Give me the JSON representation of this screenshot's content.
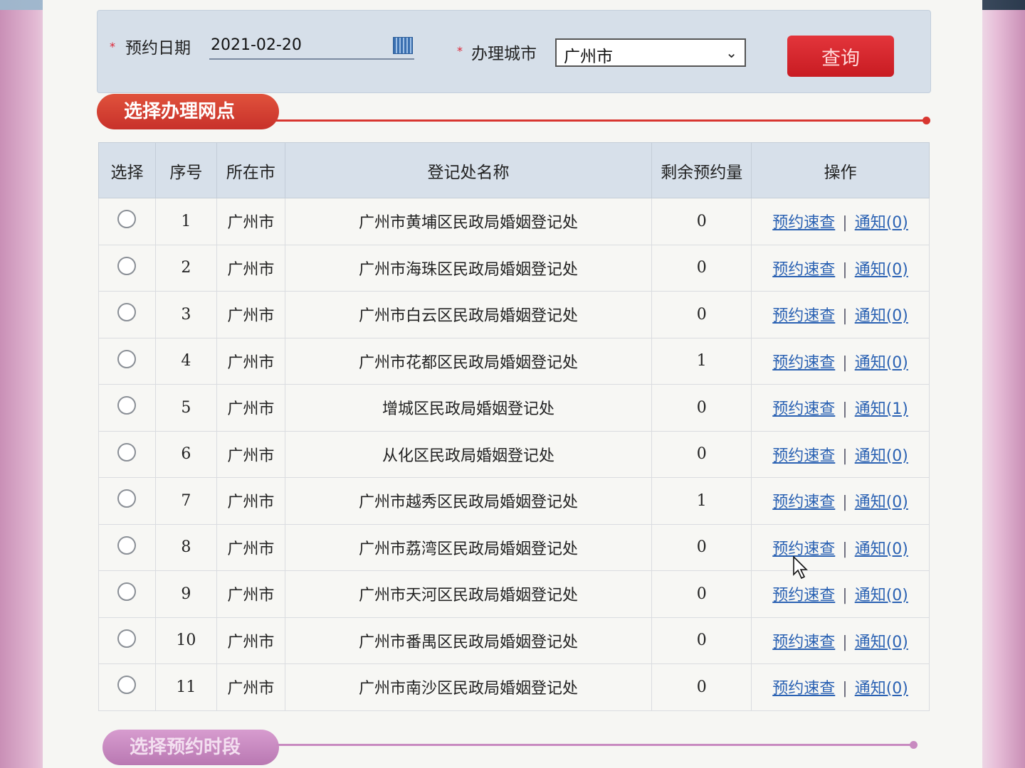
{
  "form": {
    "date_label": "预约日期",
    "date_value": "2021-02-20",
    "city_label": "办理城市",
    "city_value": "广州市",
    "query_button": "查询",
    "required_mark": "*"
  },
  "sections": {
    "select_office": "选择办理网点",
    "select_time": "选择预约时段"
  },
  "table": {
    "headers": [
      "选择",
      "序号",
      "所在市",
      "登记处名称",
      "剩余预约量",
      "操作"
    ],
    "quick_query_label": "预约速查",
    "separator": "|",
    "rows": [
      {
        "seq": "1",
        "city": "广州市",
        "name": "广州市黄埔区民政局婚姻登记处",
        "remaining": "0",
        "notice": "通知(0)"
      },
      {
        "seq": "2",
        "city": "广州市",
        "name": "广州市海珠区民政局婚姻登记处",
        "remaining": "0",
        "notice": "通知(0)"
      },
      {
        "seq": "3",
        "city": "广州市",
        "name": "广州市白云区民政局婚姻登记处",
        "remaining": "0",
        "notice": "通知(0)"
      },
      {
        "seq": "4",
        "city": "广州市",
        "name": "广州市花都区民政局婚姻登记处",
        "remaining": "1",
        "notice": "通知(0)"
      },
      {
        "seq": "5",
        "city": "广州市",
        "name": "增城区民政局婚姻登记处",
        "remaining": "0",
        "notice": "通知(1)"
      },
      {
        "seq": "6",
        "city": "广州市",
        "name": "从化区民政局婚姻登记处",
        "remaining": "0",
        "notice": "通知(0)"
      },
      {
        "seq": "7",
        "city": "广州市",
        "name": "广州市越秀区民政局婚姻登记处",
        "remaining": "1",
        "notice": "通知(0)"
      },
      {
        "seq": "8",
        "city": "广州市",
        "name": "广州市荔湾区民政局婚姻登记处",
        "remaining": "0",
        "notice": "通知(0)"
      },
      {
        "seq": "9",
        "city": "广州市",
        "name": "广州市天河区民政局婚姻登记处",
        "remaining": "0",
        "notice": "通知(0)"
      },
      {
        "seq": "10",
        "city": "广州市",
        "name": "广州市番禺区民政局婚姻登记处",
        "remaining": "0",
        "notice": "通知(0)"
      },
      {
        "seq": "11",
        "city": "广州市",
        "name": "广州市南沙区民政局婚姻登记处",
        "remaining": "0",
        "notice": "通知(0)"
      }
    ]
  },
  "colors": {
    "accent_red": "#d8362f",
    "link_blue": "#2b62b3",
    "section2_pink": "#c88ac0"
  }
}
